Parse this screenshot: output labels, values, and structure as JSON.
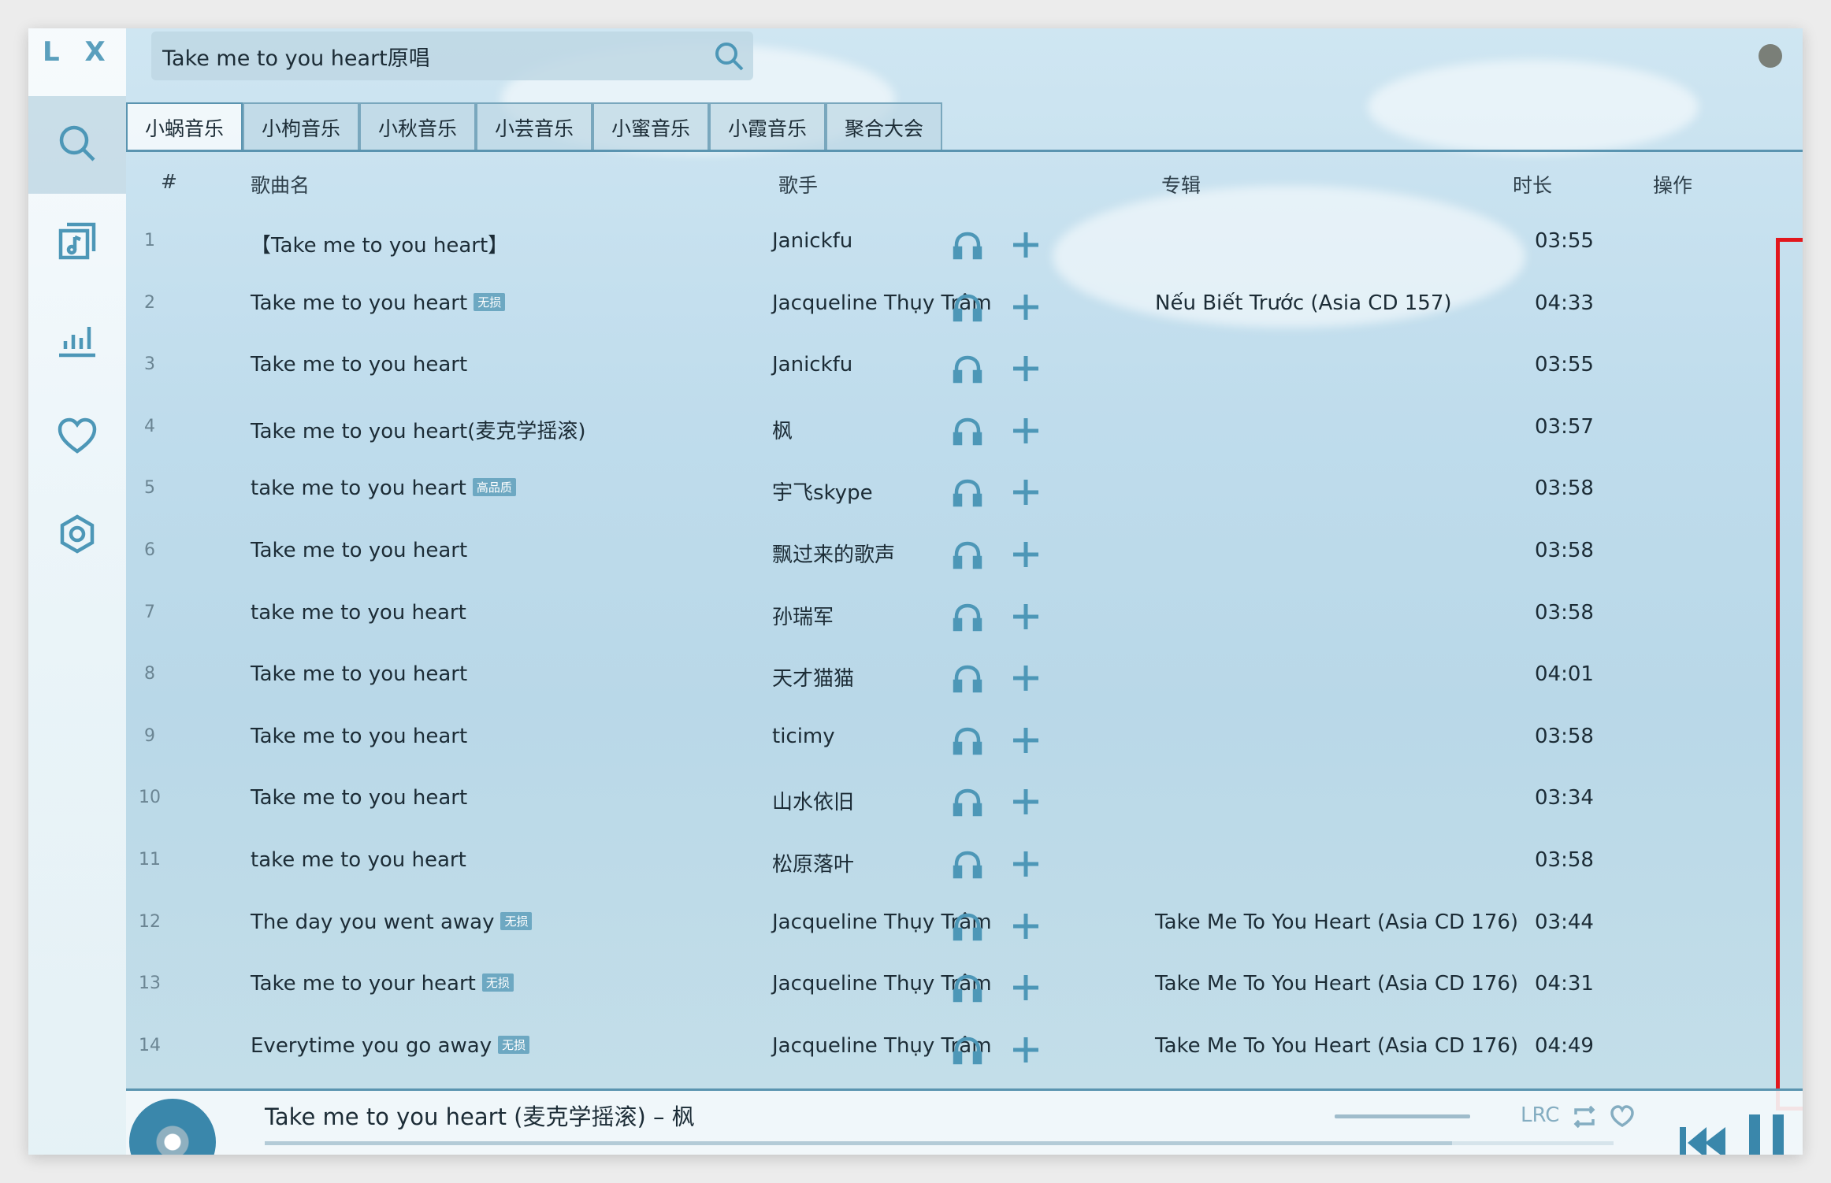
{
  "logo": "L X",
  "search": {
    "value": "Take me to you heart原唱"
  },
  "tabs": [
    {
      "label": "小蜗音乐",
      "active": true
    },
    {
      "label": "小枸音乐",
      "active": false
    },
    {
      "label": "小秋音乐",
      "active": false
    },
    {
      "label": "小芸音乐",
      "active": false
    },
    {
      "label": "小蜜音乐",
      "active": false
    },
    {
      "label": "小霞音乐",
      "active": false
    },
    {
      "label": "聚合大会",
      "active": false
    }
  ],
  "table": {
    "headers": {
      "num": "#",
      "name": "歌曲名",
      "singer": "歌手",
      "album": "专辑",
      "duration": "时长",
      "actions": "操作"
    },
    "rows": [
      {
        "num": "1",
        "name": "【Take me to you heart】",
        "badge": "",
        "singer": "Janickfu",
        "album": "",
        "duration": "03:55"
      },
      {
        "num": "2",
        "name": "Take me to you heart",
        "badge": "无损",
        "singer": "Jacqueline Thụy Trâm",
        "album": "Nếu Biết Trước (Asia CD 157)",
        "duration": "04:33"
      },
      {
        "num": "3",
        "name": "Take me to you heart",
        "badge": "",
        "singer": "Janickfu",
        "album": "",
        "duration": "03:55"
      },
      {
        "num": "4",
        "name": "Take me to you heart(麦克学摇滚)",
        "badge": "",
        "singer": "枫",
        "album": "",
        "duration": "03:57"
      },
      {
        "num": "5",
        "name": "take me to you heart",
        "badge": "高品质",
        "singer": "宇飞skype",
        "album": "",
        "duration": "03:58"
      },
      {
        "num": "6",
        "name": "Take me to you heart",
        "badge": "",
        "singer": "飘过来的歌声",
        "album": "",
        "duration": "03:58"
      },
      {
        "num": "7",
        "name": "take me to you heart",
        "badge": "",
        "singer": "孙瑞军",
        "album": "",
        "duration": "03:58"
      },
      {
        "num": "8",
        "name": "Take me to you heart",
        "badge": "",
        "singer": "天才猫猫",
        "album": "",
        "duration": "04:01"
      },
      {
        "num": "9",
        "name": "Take me to you heart",
        "badge": "",
        "singer": "ticimy",
        "album": "",
        "duration": "03:58"
      },
      {
        "num": "10",
        "name": "Take me to you heart",
        "badge": "",
        "singer": "山水依旧",
        "album": "",
        "duration": "03:34"
      },
      {
        "num": "11",
        "name": "take me to you heart",
        "badge": "",
        "singer": "松原落叶",
        "album": "",
        "duration": "03:58"
      },
      {
        "num": "12",
        "name": "The day you went away",
        "badge": "无损",
        "singer": "Jacqueline Thụy Trâm",
        "album": "Take Me To You Heart (Asia CD 176)",
        "duration": "03:44"
      },
      {
        "num": "13",
        "name": "Take me to your heart",
        "badge": "无损",
        "singer": "Jacqueline Thụy Trâm",
        "album": "Take Me To You Heart (Asia CD 176)",
        "duration": "04:31"
      },
      {
        "num": "14",
        "name": "Everytime you go away",
        "badge": "无损",
        "singer": "Jacqueline Thụy Trâm",
        "album": "Take Me To You Heart (Asia CD 176)",
        "duration": "04:49"
      }
    ]
  },
  "player": {
    "now_playing": "Take me to you heart (麦克学摇滚) – 枫",
    "lrc_label": "LRC",
    "progress": 0.88
  },
  "icons": {
    "sidebar": [
      "search-icon",
      "music-list-icon",
      "chart-icon",
      "heart-icon",
      "settings-icon"
    ],
    "row_actions": [
      "headphones-icon",
      "plus-icon"
    ]
  },
  "colors": {
    "accent": "#4d97b7",
    "highlight": "#e2171d",
    "badge": "#6da8c2"
  }
}
